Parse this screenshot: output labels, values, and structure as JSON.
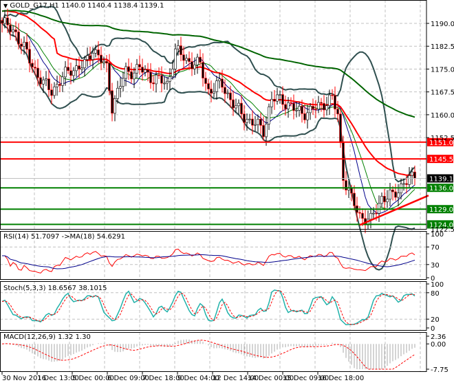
{
  "header": {
    "symbol_line": "GOLD_G17,H1  1140.0 1140.4 1138.4 1139.1"
  },
  "chart_data": {
    "type": "candlestick",
    "symbol": "GOLD_G17",
    "timeframe": "H1",
    "ohlc_last": {
      "open": 1140.0,
      "high": 1140.4,
      "low": 1138.4,
      "close": 1139.1
    },
    "ylim": [
      1122.5,
      1197
    ],
    "y_ticks": [
      "1190.0",
      "1182.5",
      "1175.0",
      "1167.5",
      "1160.0",
      "1152.5",
      "1122.5"
    ],
    "x_ticks": [
      "30 Nov 2016",
      "1 Dec 13:00",
      "5 Dec 00:00",
      "6 Dec 09:00",
      "7 Dec 18:00",
      "9 Dec 04:00",
      "12 Dec 14:00",
      "14 Dec 00:00",
      "15 Dec 09:00",
      "16 Dec 18:00"
    ],
    "close_anchors": [
      [
        0,
        1190
      ],
      [
        5,
        1187
      ],
      [
        10,
        1178
      ],
      [
        15,
        1170
      ],
      [
        18,
        1168
      ],
      [
        25,
        1175
      ],
      [
        30,
        1176
      ],
      [
        33,
        1182
      ],
      [
        38,
        1175
      ],
      [
        40,
        1163
      ],
      [
        45,
        1174
      ],
      [
        50,
        1175
      ],
      [
        55,
        1172
      ],
      [
        60,
        1170
      ],
      [
        63,
        1181
      ],
      [
        67,
        1178
      ],
      [
        72,
        1176
      ],
      [
        75,
        1168
      ],
      [
        80,
        1170
      ],
      [
        85,
        1162
      ],
      [
        90,
        1158
      ],
      [
        95,
        1155
      ],
      [
        98,
        1165
      ],
      [
        102,
        1165
      ],
      [
        107,
        1161
      ],
      [
        112,
        1161
      ],
      [
        117,
        1164
      ],
      [
        120,
        1165
      ],
      [
        122,
        1160
      ],
      [
        124,
        1140
      ],
      [
        127,
        1132
      ],
      [
        130,
        1127
      ],
      [
        134,
        1125
      ],
      [
        138,
        1133
      ],
      [
        142,
        1133
      ],
      [
        146,
        1138
      ],
      [
        150,
        1139.1
      ]
    ],
    "levels": [
      {
        "price": 1151.0,
        "label": "1151.0",
        "color": "#ff0000"
      },
      {
        "price": 1145.5,
        "label": "1145.5",
        "color": "#ff0000"
      },
      {
        "price": 1136.0,
        "label": "1136.0",
        "color": "#008000"
      },
      {
        "price": 1129.0,
        "label": "1129.0",
        "color": "#008000"
      },
      {
        "price": 1124.0,
        "label": "1124.0",
        "color": "#008000"
      }
    ],
    "current_price": {
      "price": 1139.1,
      "label": "1139.1"
    },
    "trendline": {
      "from": [
        130,
        1123.8
      ],
      "to": [
        155,
        1133.5
      ],
      "color": "#ff0000"
    },
    "rsi": {
      "title": "RSI(14) 51.7097  ->MA(18) 54.6291",
      "ticks": [
        "100",
        "70",
        "30",
        "0"
      ]
    },
    "stoch": {
      "title": "Stoch(5,3,3) 18.6567 38.1015",
      "ticks": [
        "100",
        "80",
        "20",
        "0"
      ]
    },
    "macd": {
      "title": "MACD(12,26,9) 1.32 1.30",
      "ticks": [
        "2.36",
        "0.00",
        "-7.75"
      ],
      "range": [
        -7.75,
        2.36
      ]
    }
  }
}
